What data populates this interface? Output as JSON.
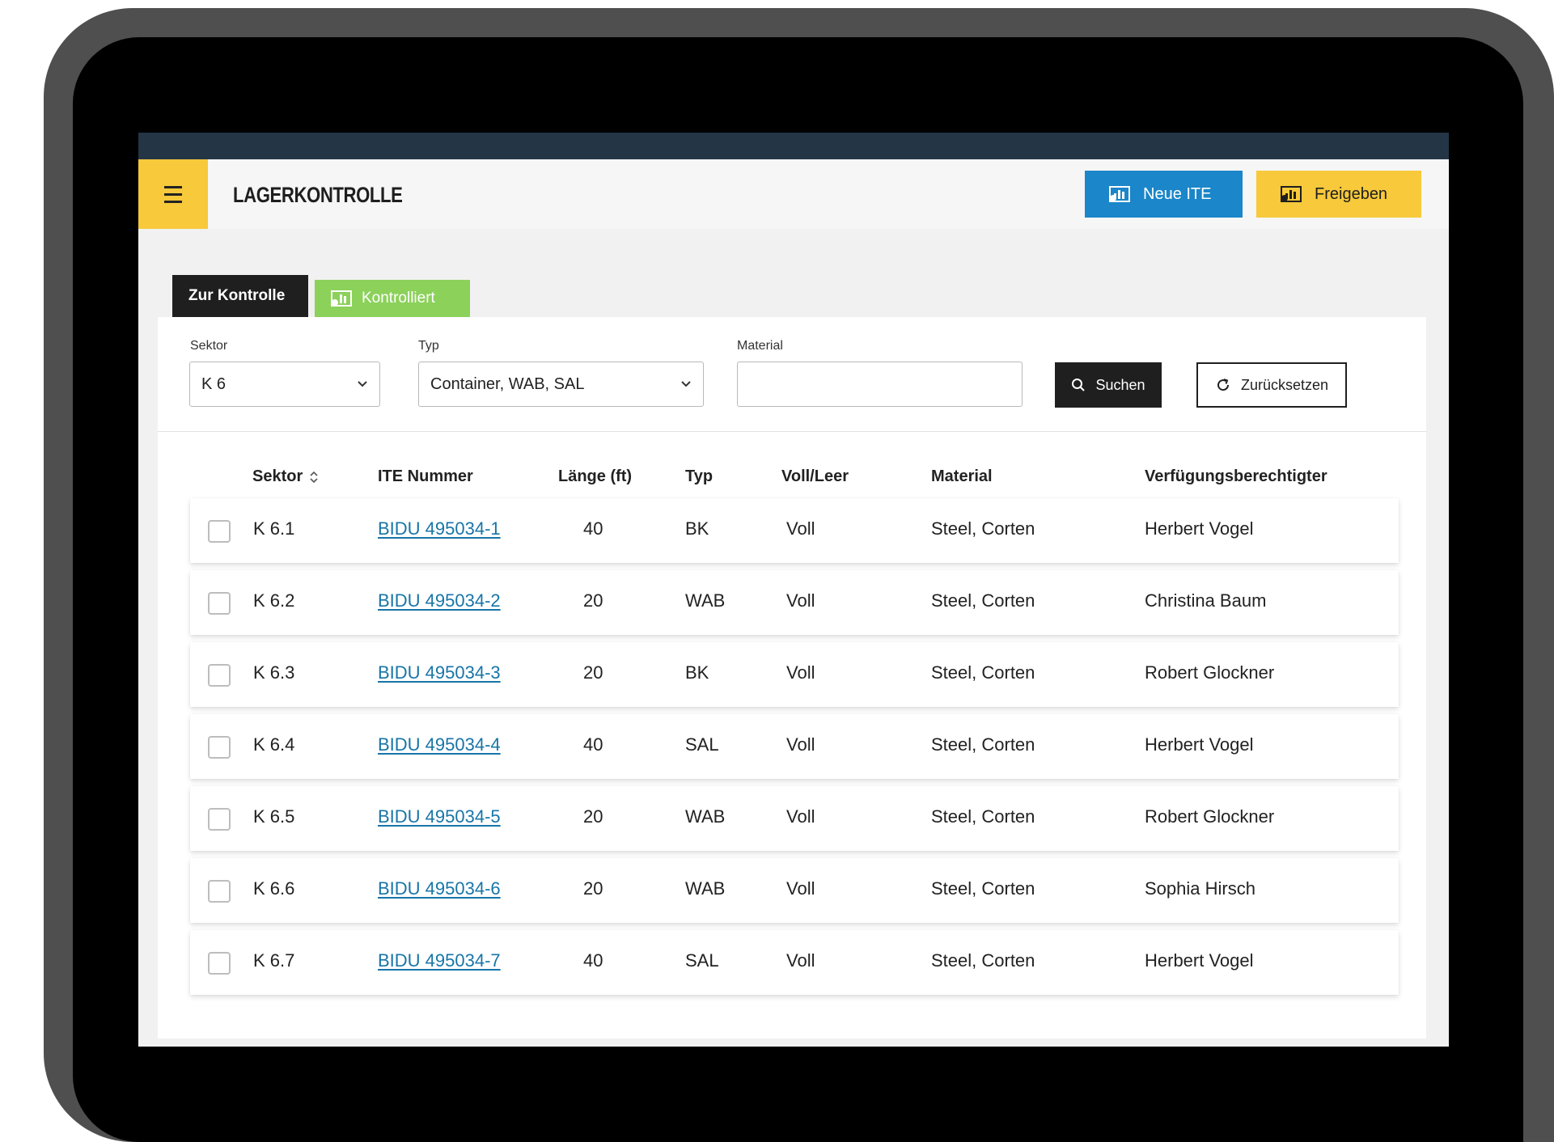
{
  "app": {
    "title": "LAGERKONTROLLE",
    "buttons": {
      "new_ite": "Neue ITE",
      "release": "Freigeben"
    }
  },
  "tabs": [
    {
      "label": "Zur Kontrolle",
      "active": true
    },
    {
      "label": "Kontrolliert",
      "active": false
    }
  ],
  "filters": {
    "sector": {
      "label": "Sektor",
      "value": "K 6"
    },
    "type": {
      "label": "Typ",
      "value": "Container, WAB, SAL"
    },
    "material": {
      "label": "Material",
      "value": "",
      "placeholder": ""
    },
    "search_label": "Suchen",
    "reset_label": "Zurücksetzen"
  },
  "table": {
    "columns": [
      "Sektor",
      "ITE Nummer",
      "Länge (ft)",
      "Typ",
      "Voll/Leer",
      "Material",
      "Verfügungsberechtigter"
    ],
    "rows": [
      {
        "sector": "K 6.1",
        "ite": "BIDU 495034-1",
        "length": "40",
        "type": "BK",
        "fill": "Voll",
        "material": "Steel, Corten",
        "owner": "Herbert Vogel"
      },
      {
        "sector": "K 6.2",
        "ite": "BIDU 495034-2",
        "length": "20",
        "type": "WAB",
        "fill": "Voll",
        "material": "Steel, Corten",
        "owner": "Christina Baum"
      },
      {
        "sector": "K 6.3",
        "ite": "BIDU 495034-3",
        "length": "20",
        "type": "BK",
        "fill": "Voll",
        "material": "Steel, Corten",
        "owner": "Robert Glockner"
      },
      {
        "sector": "K 6.4",
        "ite": "BIDU 495034-4",
        "length": "40",
        "type": "SAL",
        "fill": "Voll",
        "material": "Steel, Corten",
        "owner": "Herbert Vogel"
      },
      {
        "sector": "K 6.5",
        "ite": "BIDU 495034-5",
        "length": "20",
        "type": "WAB",
        "fill": "Voll",
        "material": "Steel, Corten",
        "owner": "Robert Glockner"
      },
      {
        "sector": "K 6.6",
        "ite": "BIDU 495034-6",
        "length": "20",
        "type": "WAB",
        "fill": "Voll",
        "material": "Steel, Corten",
        "owner": "Sophia Hirsch"
      },
      {
        "sector": "K 6.7",
        "ite": "BIDU 495034-7",
        "length": "40",
        "type": "SAL",
        "fill": "Voll",
        "material": "Steel, Corten",
        "owner": "Herbert Vogel"
      }
    ]
  },
  "icons": {
    "menu": "hamburger-menu-icon",
    "ite": "container-chart-icon",
    "search": "magnifier-icon",
    "reset": "refresh-icon",
    "dropdown": "chevron-down-icon",
    "sort": "sort-up-down-icon"
  },
  "colors": {
    "accent_yellow": "#f7c93b",
    "primary_blue": "#1b86c9",
    "success_green": "#8bd15a",
    "header_dark": "#243545",
    "link_blue": "#1775a8"
  }
}
